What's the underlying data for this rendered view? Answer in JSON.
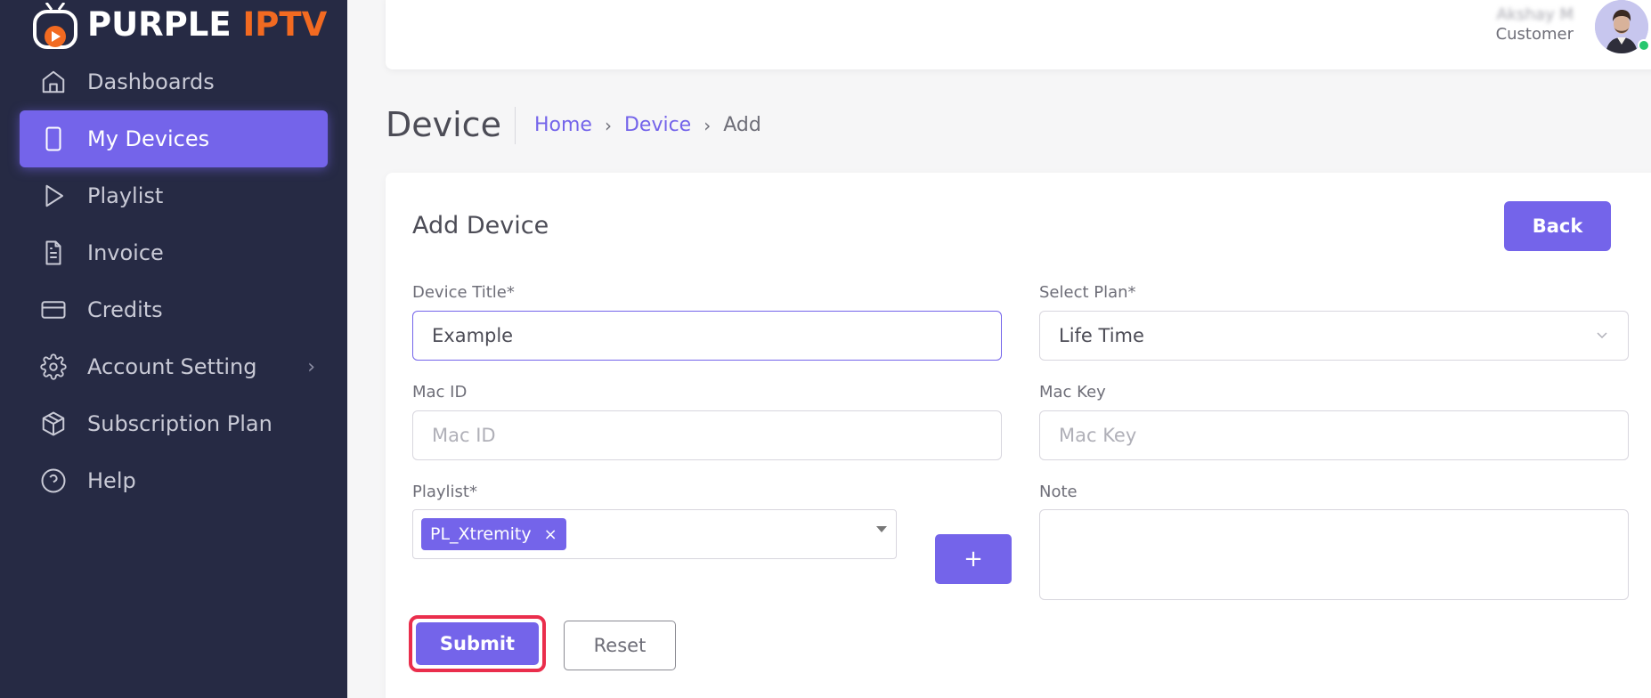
{
  "brand": {
    "name_white": "PURPLE ",
    "name_orange": "IPTV",
    "orange": "#f26a21",
    "accent": "#7464ea"
  },
  "sidebar": {
    "items": [
      {
        "label": "Dashboards",
        "icon": "home-icon"
      },
      {
        "label": "My Devices",
        "icon": "smartphone-icon",
        "active": true
      },
      {
        "label": "Playlist",
        "icon": "play-icon"
      },
      {
        "label": "Invoice",
        "icon": "file-text-icon"
      },
      {
        "label": "Credits",
        "icon": "credit-card-icon"
      },
      {
        "label": "Account Setting",
        "icon": "gear-icon",
        "has_submenu": true
      },
      {
        "label": "Subscription Plan",
        "icon": "package-icon"
      },
      {
        "label": "Help",
        "icon": "help-circle-icon"
      }
    ]
  },
  "topbar": {
    "user_name": "Akshay M",
    "user_role": "Customer"
  },
  "header": {
    "title": "Device",
    "breadcrumb": {
      "home": "Home",
      "device": "Device",
      "current": "Add"
    }
  },
  "form": {
    "title": "Add Device",
    "back_label": "Back",
    "device_title": {
      "label": "Device Title*",
      "value": "Example"
    },
    "plan": {
      "label": "Select Plan*",
      "value": "Life Time"
    },
    "mac_id": {
      "label": "Mac ID",
      "placeholder": "Mac ID"
    },
    "mac_key": {
      "label": "Mac Key",
      "placeholder": "Mac Key"
    },
    "playlist": {
      "label": "Playlist*",
      "selected": "PL_Xtremity",
      "remove": "×"
    },
    "add_label": "+",
    "note": {
      "label": "Note"
    },
    "submit_label": "Submit",
    "reset_label": "Reset"
  }
}
